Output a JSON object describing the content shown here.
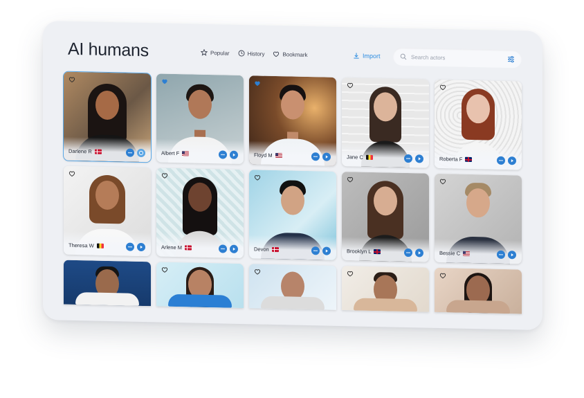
{
  "title": "AI humans",
  "nav": [
    {
      "label": "Popular",
      "icon": "star-icon"
    },
    {
      "label": "History",
      "icon": "clock-icon"
    },
    {
      "label": "Bookmark",
      "icon": "heart-outline-icon"
    }
  ],
  "import_label": "Import",
  "search": {
    "placeholder": "Search actors"
  },
  "colors": {
    "accent": "#2d7fd2",
    "panel": "#eef0f4",
    "active_border": "#58a8e8"
  },
  "actors": [
    {
      "name": "Darlene R",
      "flag": "dk",
      "bookmarked": false,
      "active": true
    },
    {
      "name": "Albert F",
      "flag": "us",
      "bookmarked": true
    },
    {
      "name": "Floyd M",
      "flag": "us",
      "bookmarked": true
    },
    {
      "name": "Jane C",
      "flag": "be",
      "bookmarked": false
    },
    {
      "name": "Roberta F",
      "flag": "gb",
      "bookmarked": false
    },
    {
      "name": "Theresa W",
      "flag": "be",
      "bookmarked": false
    },
    {
      "name": "Arlene M",
      "flag": "dk",
      "bookmarked": false
    },
    {
      "name": "Devon",
      "flag": "dk",
      "bookmarked": false
    },
    {
      "name": "Brooklyn  L",
      "flag": "gb",
      "bookmarked": false
    },
    {
      "name": "Bessie C",
      "flag": "us",
      "bookmarked": false
    },
    {
      "name": "",
      "flag": "",
      "bookmarked": false,
      "partial": true
    },
    {
      "name": "",
      "flag": "",
      "bookmarked": false,
      "partial": true
    },
    {
      "name": "",
      "flag": "",
      "bookmarked": false,
      "partial": true
    },
    {
      "name": "",
      "flag": "",
      "bookmarked": false,
      "partial": true
    },
    {
      "name": "",
      "flag": "",
      "bookmarked": false,
      "partial": true
    }
  ]
}
